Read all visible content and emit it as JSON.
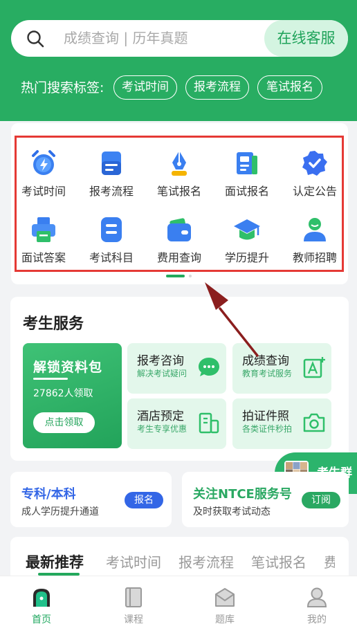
{
  "search": {
    "placeholder": "成绩查询 | 历年真题",
    "service_button": "在线客服"
  },
  "hot": {
    "label": "热门搜索标签:",
    "tags": [
      "考试时间",
      "报考流程",
      "笔试报名"
    ]
  },
  "grid": [
    {
      "label": "考试时间",
      "icon": "alarm-clock-icon"
    },
    {
      "label": "报考流程",
      "icon": "document-icon"
    },
    {
      "label": "笔试报名",
      "icon": "pen-nib-icon"
    },
    {
      "label": "面试报名",
      "icon": "notebook-icon"
    },
    {
      "label": "认定公告",
      "icon": "verified-badge-icon"
    },
    {
      "label": "面试答案",
      "icon": "printer-icon"
    },
    {
      "label": "考试科目",
      "icon": "list-icon"
    },
    {
      "label": "费用查询",
      "icon": "wallet-icon"
    },
    {
      "label": "学历提升",
      "icon": "graduation-cap-icon"
    },
    {
      "label": "教师招聘",
      "icon": "teacher-icon"
    }
  ],
  "services": {
    "title": "考生服务",
    "unlock": {
      "title": "解锁资料包",
      "count": "27862人领取",
      "button": "点击领取"
    },
    "items": [
      {
        "title": "报考咨询",
        "sub": "解决考试疑问",
        "icon": "chat-icon"
      },
      {
        "title": "成绩查询",
        "sub": "教育考试服务",
        "icon": "text-edit-icon"
      },
      {
        "title": "酒店预定",
        "sub": "考生专享优惠",
        "icon": "building-icon"
      },
      {
        "title": "拍证件照",
        "sub": "各类证件秒拍",
        "icon": "camera-icon"
      }
    ]
  },
  "float": {
    "label": "考生群"
  },
  "promo": [
    {
      "title": "专科/本科",
      "sub": "成人学历提升通道",
      "badge": "报名"
    },
    {
      "title": "关注NTCE服务号",
      "sub": "及时获取考试动态",
      "badge": "订阅"
    }
  ],
  "recommend": {
    "tabs": [
      "最新推荐",
      "考试时间",
      "报考流程",
      "笔试报名",
      "费"
    ]
  },
  "nav": [
    {
      "label": "首页",
      "icon": "home-icon"
    },
    {
      "label": "课程",
      "icon": "book-icon"
    },
    {
      "label": "题库",
      "icon": "question-bank-icon"
    },
    {
      "label": "我的",
      "icon": "profile-icon"
    }
  ],
  "colors": {
    "primary": "#28ad62",
    "highlight": "#e53935",
    "blue": "#3366e6"
  }
}
